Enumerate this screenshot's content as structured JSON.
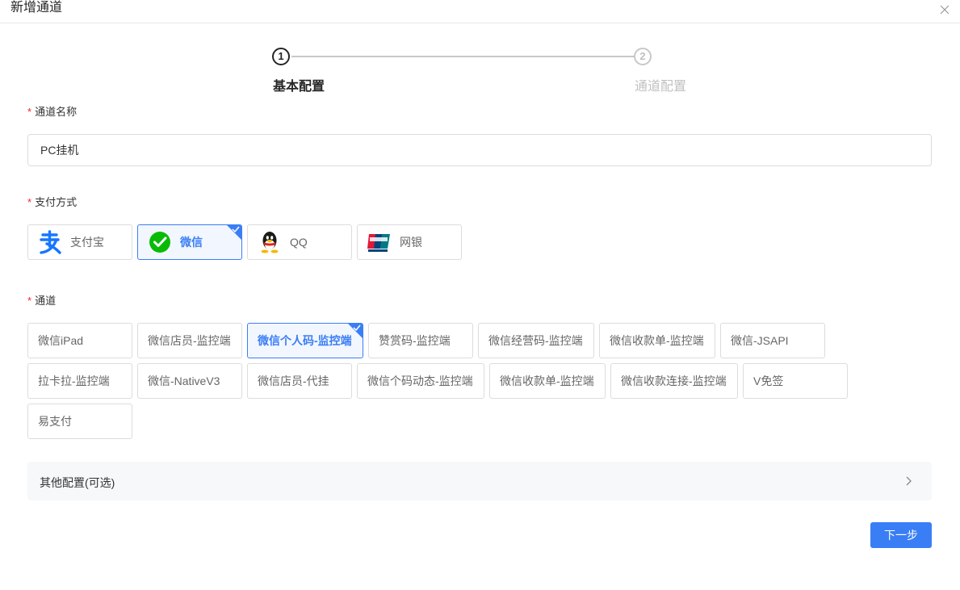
{
  "dialog": {
    "title": "新增通道"
  },
  "steps": [
    {
      "number": "1",
      "label": "基本配置",
      "state": "active"
    },
    {
      "number": "2",
      "label": "通道配置",
      "state": "inactive"
    }
  ],
  "channel_name": {
    "label": "通道名称",
    "required_mark": "*",
    "value": "PC挂机"
  },
  "payment_method": {
    "label": "支付方式",
    "required_mark": "*",
    "options": [
      {
        "label": "支付宝",
        "icon": "alipay-icon",
        "selected": false
      },
      {
        "label": "微信",
        "icon": "wechat-icon",
        "selected": true
      },
      {
        "label": "QQ",
        "icon": "qq-icon",
        "selected": false
      },
      {
        "label": "网银",
        "icon": "unionpay-icon",
        "selected": false
      }
    ]
  },
  "channel": {
    "label": "通道",
    "required_mark": "*",
    "options": [
      {
        "label": "微信iPad",
        "selected": false
      },
      {
        "label": "微信店员-监控端",
        "selected": false
      },
      {
        "label": "微信个人码-监控端",
        "selected": true
      },
      {
        "label": "赞赏码-监控端",
        "selected": false
      },
      {
        "label": "微信经营码-监控端",
        "selected": false
      },
      {
        "label": "微信收款单-监控端",
        "selected": false
      },
      {
        "label": "微信-JSAPI",
        "selected": false
      },
      {
        "label": "拉卡拉-监控端",
        "selected": false
      },
      {
        "label": "微信-NativeV3",
        "selected": false
      },
      {
        "label": "微信店员-代挂",
        "selected": false
      },
      {
        "label": "微信个码动态-监控端",
        "selected": false
      },
      {
        "label": "微信收款单-监控端",
        "selected": false
      },
      {
        "label": "微信收款连接-监控端",
        "selected": false
      },
      {
        "label": "V免签",
        "selected": false
      },
      {
        "label": "易支付",
        "selected": false
      }
    ]
  },
  "other_config": {
    "label": "其他配置(可选)"
  },
  "next_button": {
    "label": "下一步"
  },
  "colors": {
    "primary": "#3a7ef5",
    "required": "#f5222d",
    "wechat": "#09bb07",
    "alipay": "#1677ff"
  }
}
